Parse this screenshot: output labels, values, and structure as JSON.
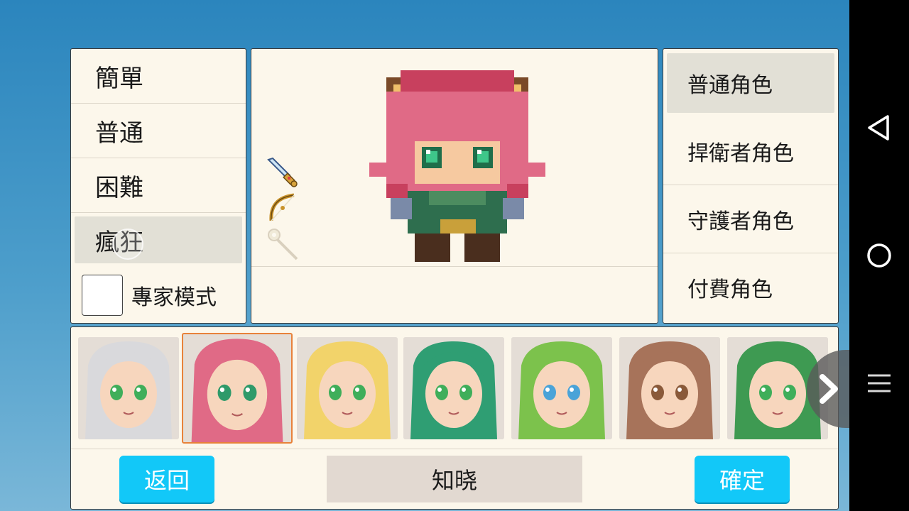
{
  "difficulty": {
    "items": [
      {
        "label": "簡單",
        "selected": false
      },
      {
        "label": "普通",
        "selected": false
      },
      {
        "label": "困難",
        "selected": false
      },
      {
        "label": "瘋狂",
        "selected": true
      }
    ],
    "expert_mode_label": "專家模式",
    "expert_mode_checked": false
  },
  "preview": {
    "character_sprite": "pink-haired-fox-girl-sprite",
    "weapons": [
      {
        "icon": "sword-icon",
        "enabled": true
      },
      {
        "icon": "bow-icon",
        "enabled": true
      },
      {
        "icon": "staff-icon",
        "enabled": false
      }
    ]
  },
  "roles": {
    "items": [
      {
        "label": "普通角色",
        "selected": true
      },
      {
        "label": "捍衛者角色",
        "selected": false
      },
      {
        "label": "守護者角色",
        "selected": false
      },
      {
        "label": "付費角色",
        "selected": false
      }
    ]
  },
  "portraits": [
    {
      "name": "silver-haired-girl",
      "hair": "#d9d9dc",
      "eyes": "#3fae5a",
      "selected": false
    },
    {
      "name": "pink-haired-fox-girl",
      "hair": "#e06a86",
      "eyes": "#2f9a6a",
      "selected": true
    },
    {
      "name": "blonde-elf-girl",
      "hair": "#f2d36a",
      "eyes": "#3fae5a",
      "selected": false
    },
    {
      "name": "green-haired-woman",
      "hair": "#2f9e73",
      "eyes": "#3fae5a",
      "selected": false
    },
    {
      "name": "lime-haired-girl",
      "hair": "#7cc24c",
      "eyes": "#4aa3d8",
      "selected": false
    },
    {
      "name": "brown-haired-girl",
      "hair": "#a7735a",
      "eyes": "#8a5a3a",
      "selected": false
    },
    {
      "name": "red-hat-green-haired-girl",
      "hair": "#3e9a52",
      "eyes": "#3fae5a",
      "selected": false
    }
  ],
  "buttons": {
    "back_label": "返回",
    "hint_label": "知晓",
    "confirm_label": "確定"
  },
  "nav": {
    "back_icon": "triangle-back-icon",
    "home_icon": "circle-home-icon",
    "menu_icon": "menu-lines-icon"
  },
  "colors": {
    "accent": "#12c8f8",
    "selected_border": "#e8823a",
    "panel_bg": "#fcf7eb",
    "selected_row": "#e2e0d6"
  }
}
